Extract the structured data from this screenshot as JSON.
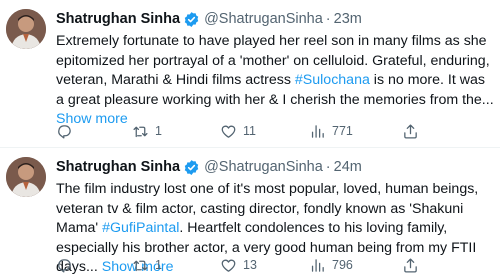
{
  "tweets": [
    {
      "author_name": "Shatrughan Sinha",
      "handle": "@ShatruganSinha",
      "separator": "·",
      "time": "23m",
      "text_before": "Extremely fortunate to have played her reel son in many films as she epitomized her portrayal of a 'mother' on celluloid. Grateful, enduring, veteran, Marathi & Hindi films actress ",
      "hashtag": "#Sulochana",
      "text_after": " is no more. It was a great pleasure working with her & I cherish the memories from the... ",
      "show_more": "Show more",
      "reply_count": "",
      "retweet_count": "1",
      "like_count": "11",
      "view_count": "771"
    },
    {
      "author_name": "Shatrughan Sinha",
      "handle": "@ShatruganSinha",
      "separator": "·",
      "time": "24m",
      "text_before": "The film industry lost one of it's most popular, loved, human beings, veteran tv & film actor, casting director, fondly known as 'Shakuni Mama' ",
      "hashtag": "#GufiPaintal",
      "text_after": ".  Heartfelt condolences to his loving family, especially his brother actor, a very good human being from my FTII days... ",
      "show_more": "Show more",
      "reply_count": "",
      "retweet_count": "1",
      "like_count": "13",
      "view_count": "796"
    }
  ],
  "icons": {
    "verified": "verified-badge-icon",
    "reply": "reply-icon",
    "retweet": "retweet-icon",
    "like": "heart-icon",
    "views": "views-bar-chart-icon",
    "share": "share-icon"
  },
  "colors": {
    "link": "#1d9bf0",
    "muted": "#536471",
    "text": "#0f1419"
  }
}
